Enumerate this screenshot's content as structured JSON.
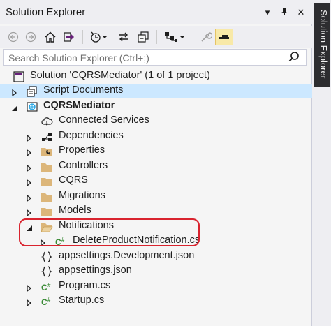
{
  "title_bar": {
    "title": "Solution Explorer"
  },
  "search": {
    "placeholder": "Search Solution Explorer (Ctrl+;)"
  },
  "side_tab": {
    "label": "Solution Explorer"
  },
  "tree": {
    "solution": "Solution 'CQRSMediator' (1 of 1 project)",
    "script_documents": "Script Documents",
    "project": "CQRSMediator",
    "connected_services": "Connected Services",
    "dependencies": "Dependencies",
    "properties": "Properties",
    "controllers": "Controllers",
    "cqrs": "CQRS",
    "migrations": "Migrations",
    "models": "Models",
    "notifications": "Notifications",
    "delete_product_notification": "DeleteProductNotification.cs",
    "appsettings_dev": "appsettings.Development.json",
    "appsettings": "appsettings.json",
    "program": "Program.cs",
    "startup": "Startup.cs"
  },
  "colors": {
    "selection": "#cce8ff",
    "highlight_box": "#d9232e",
    "folder": "#dcb67a",
    "csharp": "#388a34"
  }
}
